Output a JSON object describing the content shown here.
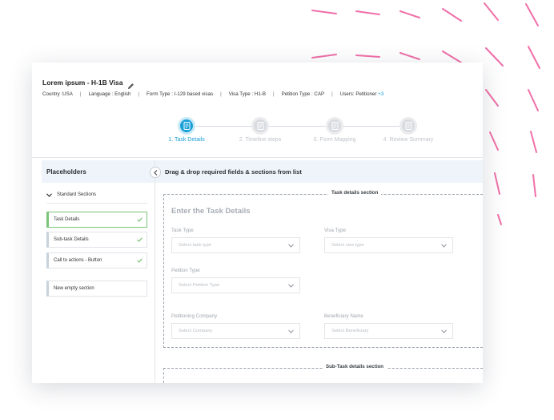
{
  "header": {
    "title": "Lorem ipsum - H-1B Visa",
    "meta": {
      "country": "Country :USA",
      "language": "Language : English",
      "form_type": "Form Type : I-129 based visas",
      "visa_type": "Visa Type : H1-B",
      "petition_type": "Petition Type : CAP",
      "users": "Users:  Petitioner",
      "users_more": "+3",
      "separator": "|"
    }
  },
  "stepper": {
    "steps": [
      {
        "label": "1. Task Details",
        "state": "active"
      },
      {
        "label": "2. Timeline steps",
        "state": "inactive"
      },
      {
        "label": "3. Form Mapping",
        "state": "inactive"
      },
      {
        "label": "4. Review Summary",
        "state": "inactive"
      }
    ]
  },
  "placeholders": {
    "title": "Placeholders",
    "group_label": "Standard Sections",
    "items": [
      {
        "label": "Task Details",
        "checked": true,
        "selected": true
      },
      {
        "label": "Sub-task Details",
        "checked": true,
        "selected": false
      },
      {
        "label": "Call to actions - Button",
        "checked": true,
        "selected": false
      }
    ],
    "new_section_label": "New empty section"
  },
  "main": {
    "instruction": "Drag & drop required fields & sections from list",
    "section_label": "Task details section",
    "form_title": "Enter the Task Details",
    "fields": {
      "task_type": {
        "label": "Task Type",
        "placeholder": "Select task type"
      },
      "visa_type": {
        "label": "Visa Type",
        "placeholder": "Select visa type"
      },
      "petition_type": {
        "label": "Petition Type",
        "placeholder": "Select Petition Type"
      },
      "petitioning_company": {
        "label": "Petitioning Company",
        "placeholder": "Select Company"
      },
      "beneficiary_name": {
        "label": "Beneficiary Name",
        "placeholder": "Select Beneficiary"
      }
    },
    "sub_section_label": "Sub-Task details section"
  },
  "colors": {
    "accent": "#1aa0d8",
    "success": "#7cc47a",
    "decor": "#f06fa8"
  },
  "icons": {
    "edit": "pencil-icon",
    "collapse": "chevron-left-icon",
    "group": "chevron-down-icon",
    "step": "document-icon",
    "done": "check-icon",
    "select": "chevron-down-icon"
  }
}
